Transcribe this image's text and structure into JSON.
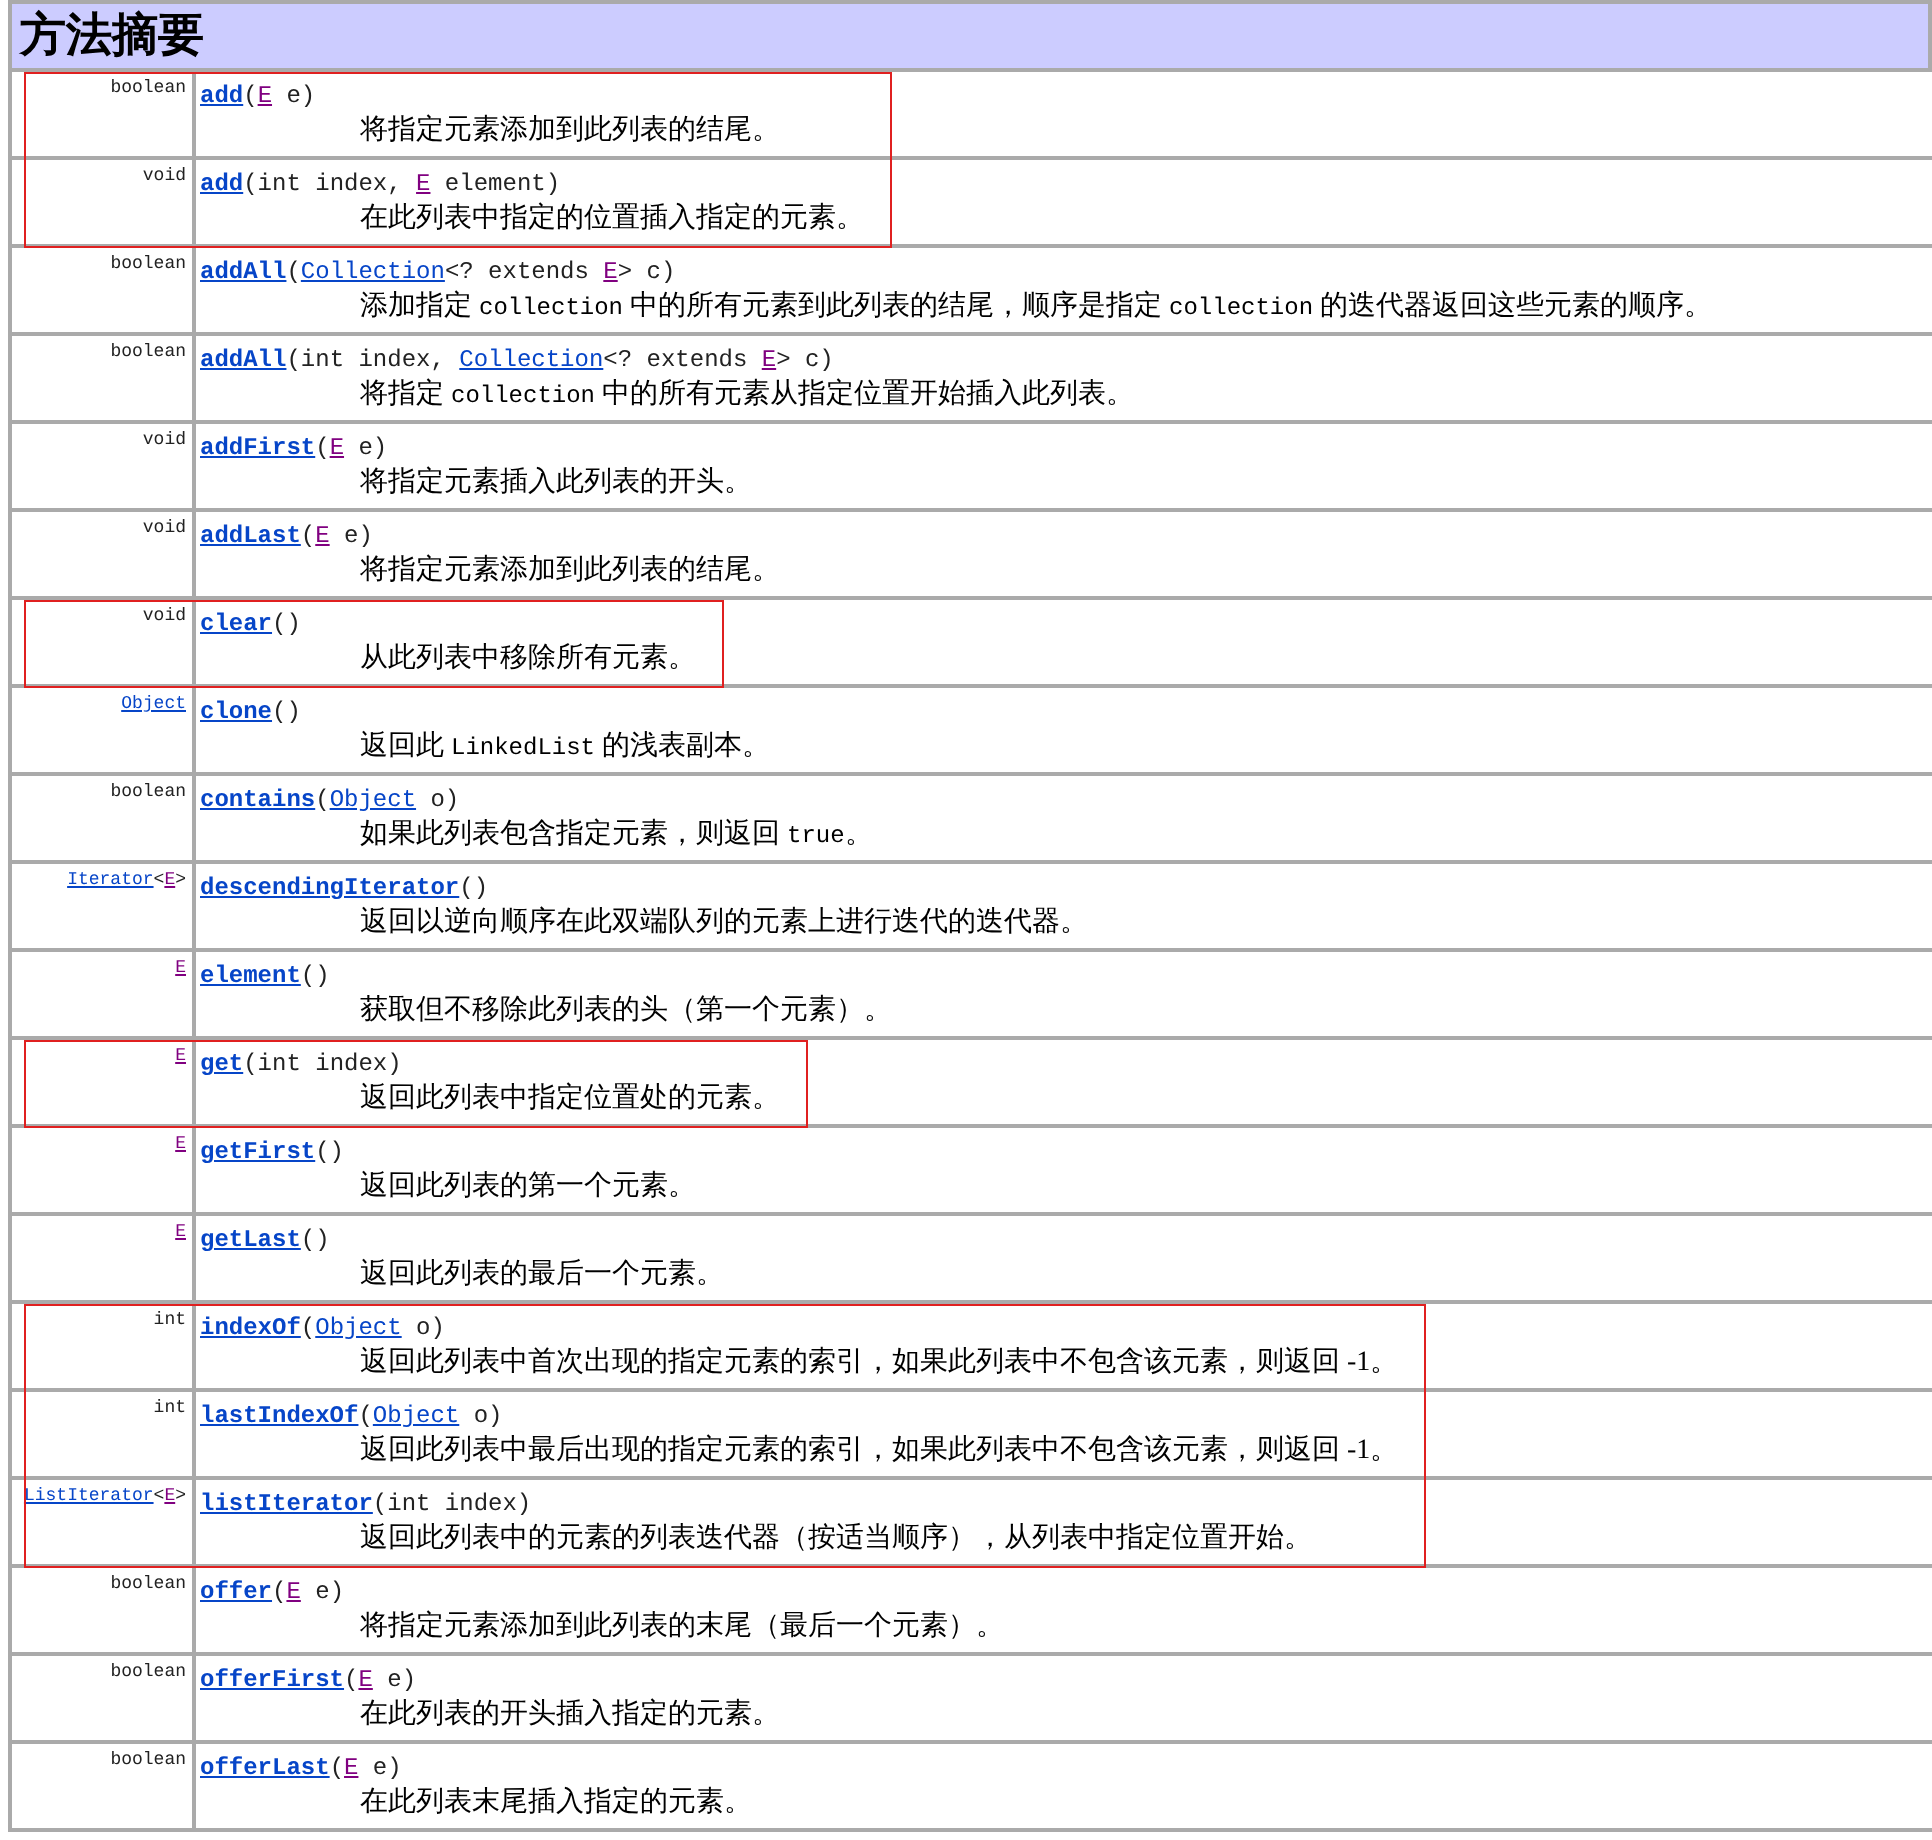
{
  "title": "方法摘要",
  "methods": [
    {
      "returns": [
        {
          "text": "boolean",
          "kind": "plain"
        }
      ],
      "name": "add",
      "params": [
        {
          "text": "(",
          "kind": "plain"
        },
        {
          "text": "E",
          "kind": "visited"
        },
        {
          "text": " e)",
          "kind": "plain"
        }
      ],
      "description": "将指定元素添加到此列表的结尾。",
      "highlighted": true
    },
    {
      "returns": [
        {
          "text": "void",
          "kind": "plain"
        }
      ],
      "name": "add",
      "params": [
        {
          "text": "(int index, ",
          "kind": "plain"
        },
        {
          "text": "E",
          "kind": "visited"
        },
        {
          "text": " element)",
          "kind": "plain"
        }
      ],
      "description": "在此列表中指定的位置插入指定的元素。",
      "highlighted": true
    },
    {
      "returns": [
        {
          "text": "boolean",
          "kind": "plain"
        }
      ],
      "name": "addAll",
      "params": [
        {
          "text": "(",
          "kind": "plain"
        },
        {
          "text": "Collection",
          "kind": "link"
        },
        {
          "text": "<? extends ",
          "kind": "plain"
        },
        {
          "text": "E",
          "kind": "visited"
        },
        {
          "text": "> c)",
          "kind": "plain"
        }
      ],
      "description": [
        {
          "text": "添加指定 ",
          "kind": "text"
        },
        {
          "text": "collection",
          "kind": "code"
        },
        {
          "text": " 中的所有元素到此列表的结尾，顺序是指定 ",
          "kind": "text"
        },
        {
          "text": "collection",
          "kind": "code"
        },
        {
          "text": " 的迭代器返回这些元素的顺序。",
          "kind": "text"
        }
      ],
      "highlighted": false
    },
    {
      "returns": [
        {
          "text": "boolean",
          "kind": "plain"
        }
      ],
      "name": "addAll",
      "params": [
        {
          "text": "(int index, ",
          "kind": "plain"
        },
        {
          "text": "Collection",
          "kind": "link"
        },
        {
          "text": "<? extends ",
          "kind": "plain"
        },
        {
          "text": "E",
          "kind": "visited"
        },
        {
          "text": "> c)",
          "kind": "plain"
        }
      ],
      "description": [
        {
          "text": "将指定 ",
          "kind": "text"
        },
        {
          "text": "collection",
          "kind": "code"
        },
        {
          "text": " 中的所有元素从指定位置开始插入此列表。",
          "kind": "text"
        }
      ],
      "highlighted": false
    },
    {
      "returns": [
        {
          "text": "void",
          "kind": "plain"
        }
      ],
      "name": "addFirst",
      "params": [
        {
          "text": "(",
          "kind": "plain"
        },
        {
          "text": "E",
          "kind": "visited"
        },
        {
          "text": " e)",
          "kind": "plain"
        }
      ],
      "description": "将指定元素插入此列表的开头。",
      "highlighted": false
    },
    {
      "returns": [
        {
          "text": "void",
          "kind": "plain"
        }
      ],
      "name": "addLast",
      "params": [
        {
          "text": "(",
          "kind": "plain"
        },
        {
          "text": "E",
          "kind": "visited"
        },
        {
          "text": " e)",
          "kind": "plain"
        }
      ],
      "description": "将指定元素添加到此列表的结尾。",
      "highlighted": false
    },
    {
      "returns": [
        {
          "text": "void",
          "kind": "plain"
        }
      ],
      "name": "clear",
      "params": [
        {
          "text": "()",
          "kind": "plain"
        }
      ],
      "description": "从此列表中移除所有元素。",
      "highlighted": true
    },
    {
      "returns": [
        {
          "text": "Object",
          "kind": "link"
        }
      ],
      "name": "clone",
      "params": [
        {
          "text": "()",
          "kind": "plain"
        }
      ],
      "description": [
        {
          "text": "返回此 ",
          "kind": "text"
        },
        {
          "text": "LinkedList",
          "kind": "code"
        },
        {
          "text": " 的浅表副本。",
          "kind": "text"
        }
      ],
      "highlighted": false
    },
    {
      "returns": [
        {
          "text": "boolean",
          "kind": "plain"
        }
      ],
      "name": "contains",
      "params": [
        {
          "text": "(",
          "kind": "plain"
        },
        {
          "text": "Object",
          "kind": "link"
        },
        {
          "text": " o)",
          "kind": "plain"
        }
      ],
      "description": [
        {
          "text": "如果此列表包含指定元素，则返回 ",
          "kind": "text"
        },
        {
          "text": "true",
          "kind": "code"
        },
        {
          "text": "。",
          "kind": "text"
        }
      ],
      "highlighted": false
    },
    {
      "returns": [
        {
          "text": "Iterator",
          "kind": "link"
        },
        {
          "text": "<",
          "kind": "plain"
        },
        {
          "text": "E",
          "kind": "visited"
        },
        {
          "text": ">",
          "kind": "plain"
        }
      ],
      "name": "descendingIterator",
      "params": [
        {
          "text": "()",
          "kind": "plain"
        }
      ],
      "description": "返回以逆向顺序在此双端队列的元素上进行迭代的迭代器。",
      "highlighted": false
    },
    {
      "returns": [
        {
          "text": "E",
          "kind": "visited"
        }
      ],
      "name": "element",
      "params": [
        {
          "text": "()",
          "kind": "plain"
        }
      ],
      "description": "获取但不移除此列表的头（第一个元素）。",
      "highlighted": false
    },
    {
      "returns": [
        {
          "text": "E",
          "kind": "visited"
        }
      ],
      "name": "get",
      "params": [
        {
          "text": "(int index)",
          "kind": "plain"
        }
      ],
      "description": "返回此列表中指定位置处的元素。",
      "highlighted": true
    },
    {
      "returns": [
        {
          "text": "E",
          "kind": "visited"
        }
      ],
      "name": "getFirst",
      "params": [
        {
          "text": "()",
          "kind": "plain"
        }
      ],
      "description": "返回此列表的第一个元素。",
      "highlighted": false
    },
    {
      "returns": [
        {
          "text": "E",
          "kind": "visited"
        }
      ],
      "name": "getLast",
      "params": [
        {
          "text": "()",
          "kind": "plain"
        }
      ],
      "description": "返回此列表的最后一个元素。",
      "highlighted": false
    },
    {
      "returns": [
        {
          "text": "int",
          "kind": "plain"
        }
      ],
      "name": "indexOf",
      "params": [
        {
          "text": "(",
          "kind": "plain"
        },
        {
          "text": "Object",
          "kind": "link"
        },
        {
          "text": " o)",
          "kind": "plain"
        }
      ],
      "description": "返回此列表中首次出现的指定元素的索引，如果此列表中不包含该元素，则返回 -1。",
      "highlighted": true
    },
    {
      "returns": [
        {
          "text": "int",
          "kind": "plain"
        }
      ],
      "name": "lastIndexOf",
      "params": [
        {
          "text": "(",
          "kind": "plain"
        },
        {
          "text": "Object",
          "kind": "link"
        },
        {
          "text": " o)",
          "kind": "plain"
        }
      ],
      "description": "返回此列表中最后出现的指定元素的索引，如果此列表中不包含该元素，则返回 -1。",
      "highlighted": true
    },
    {
      "returns": [
        {
          "text": "ListIterator",
          "kind": "link"
        },
        {
          "text": "<",
          "kind": "plain"
        },
        {
          "text": "E",
          "kind": "visited"
        },
        {
          "text": ">",
          "kind": "plain"
        }
      ],
      "name": "listIterator",
      "params": [
        {
          "text": "(int index)",
          "kind": "plain"
        }
      ],
      "description": "返回此列表中的元素的列表迭代器（按适当顺序），从列表中指定位置开始。",
      "highlighted": true
    },
    {
      "returns": [
        {
          "text": "boolean",
          "kind": "plain"
        }
      ],
      "name": "offer",
      "params": [
        {
          "text": "(",
          "kind": "plain"
        },
        {
          "text": "E",
          "kind": "visited"
        },
        {
          "text": " e)",
          "kind": "plain"
        }
      ],
      "description": "将指定元素添加到此列表的末尾（最后一个元素）。",
      "highlighted": false
    },
    {
      "returns": [
        {
          "text": "boolean",
          "kind": "plain"
        }
      ],
      "name": "offerFirst",
      "params": [
        {
          "text": "(",
          "kind": "plain"
        },
        {
          "text": "E",
          "kind": "visited"
        },
        {
          "text": " e)",
          "kind": "plain"
        }
      ],
      "description": "在此列表的开头插入指定的元素。",
      "highlighted": false
    },
    {
      "returns": [
        {
          "text": "boolean",
          "kind": "plain"
        }
      ],
      "name": "offerLast",
      "params": [
        {
          "text": "(",
          "kind": "plain"
        },
        {
          "text": "E",
          "kind": "visited"
        },
        {
          "text": " e)",
          "kind": "plain"
        }
      ],
      "description": "在此列表末尾插入指定的元素。",
      "highlighted": false
    }
  ]
}
